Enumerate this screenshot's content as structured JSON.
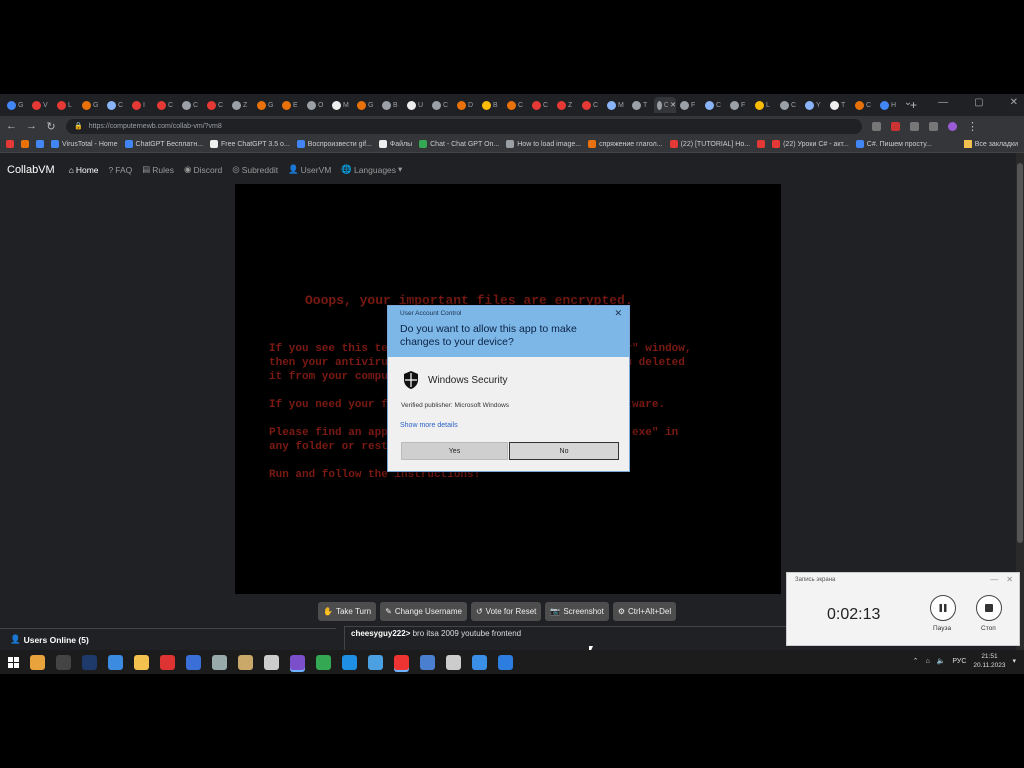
{
  "browser": {
    "tabs": [
      {
        "t": "G",
        "c": "#4285f4"
      },
      {
        "t": "V",
        "c": "#e53935"
      },
      {
        "t": "L",
        "c": "#e53935"
      },
      {
        "t": "G",
        "c": "#e8710a"
      },
      {
        "t": "C",
        "c": "#8ab4f8"
      },
      {
        "t": "I",
        "c": "#e53935"
      },
      {
        "t": "C",
        "c": "#e53935"
      },
      {
        "t": "C",
        "c": "#9aa0a6"
      },
      {
        "t": "C",
        "c": "#e53935"
      },
      {
        "t": "Z",
        "c": "#9aa0a6"
      },
      {
        "t": "G",
        "c": "#e8710a"
      },
      {
        "t": "E",
        "c": "#e8710a"
      },
      {
        "t": "O",
        "c": "#9aa0a6"
      },
      {
        "t": "M",
        "c": "#eee"
      },
      {
        "t": "G",
        "c": "#e8710a"
      },
      {
        "t": "B",
        "c": "#9aa0a6"
      },
      {
        "t": "U",
        "c": "#eee"
      },
      {
        "t": "C",
        "c": "#9aa0a6"
      },
      {
        "t": "D",
        "c": "#e8710a"
      },
      {
        "t": "B",
        "c": "#fbbc04"
      },
      {
        "t": "C",
        "c": "#e8710a"
      },
      {
        "t": "C",
        "c": "#e53935"
      },
      {
        "t": "Z",
        "c": "#e53935"
      },
      {
        "t": "C",
        "c": "#e53935"
      },
      {
        "t": "M",
        "c": "#8ab4f8"
      },
      {
        "t": "T",
        "c": "#9aa0a6"
      },
      {
        "t": "C",
        "c": "#9aa0a6"
      },
      {
        "t": "F",
        "c": "#9aa0a6"
      },
      {
        "t": "C",
        "c": "#8ab4f8"
      },
      {
        "t": "F",
        "c": "#9aa0a6"
      },
      {
        "t": "L",
        "c": "#fbbc04"
      },
      {
        "t": "C",
        "c": "#9aa0a6"
      },
      {
        "t": "Y",
        "c": "#8ab4f8"
      },
      {
        "t": "T",
        "c": "#eee"
      },
      {
        "t": "C",
        "c": "#e8710a"
      },
      {
        "t": "H",
        "c": "#4285f4"
      }
    ],
    "active_tab_index": 26,
    "new_tab": "+",
    "window_controls": [
      "⌄",
      "—",
      "▢",
      "✕"
    ],
    "url": "https://computernewb.com/collab-vm/?vm8",
    "bookmarks": [
      {
        "label": "",
        "c": "#e53935"
      },
      {
        "label": "",
        "c": "#e8710a"
      },
      {
        "label": "",
        "c": "#4285f4"
      },
      {
        "label": "VirusTotal - Home",
        "c": "#4285f4"
      },
      {
        "label": "ChatGPT Бесплатн...",
        "c": "#4285f4"
      },
      {
        "label": "Free ChatGPT 3.5 o...",
        "c": "#eee"
      },
      {
        "label": "Воспроизвести gif...",
        "c": "#4285f4"
      },
      {
        "label": "Файлы",
        "c": "#eee"
      },
      {
        "label": "Chat - Chat GPT On...",
        "c": "#34a853"
      },
      {
        "label": "How to load image...",
        "c": "#9aa0a6"
      },
      {
        "label": "спряжение глагол...",
        "c": "#e8710a"
      },
      {
        "label": "(22) [TUTORIAL] Ho...",
        "c": "#e53935"
      },
      {
        "label": "",
        "c": "#e53935"
      },
      {
        "label": "(22) Уроки C# - акт...",
        "c": "#e53935"
      },
      {
        "label": "C#. Пишем просту...",
        "c": "#4285f4"
      }
    ],
    "bookmarks_other": "Все закладки"
  },
  "site": {
    "brand": "CollabVM",
    "nav": [
      "Home",
      "FAQ",
      "Rules",
      "Discord",
      "Subreddit",
      "UserVM",
      "Languages"
    ]
  },
  "vm": {
    "ransom_title": "Ooops, your important files are encrypted.",
    "ransom_body": "If you see this text, but don't see the \"Wana Decrypt0r\" window,\nthen your antivirus removed the decrypt software or you deleted\nit from your computer.\n\nIf you need your files you have to run the decrypt software.\n\nPlease find an application file named \"@WanaDecryptor@.exe\" in\nany folder or restore from the antivirus quarantine.\n\nRun and follow the instructions!"
  },
  "uac": {
    "caption": "User Account Control",
    "question": "Do you want to allow this app to make changes to your device?",
    "app_name": "Windows Security",
    "publisher": "Verified publisher: Microsoft Windows",
    "more_details": "Show more details",
    "yes": "Yes",
    "no": "No"
  },
  "vm_buttons": [
    "Take Turn",
    "Change Username",
    "Vote for Reset",
    "Screenshot",
    "Ctrl+Alt+Del"
  ],
  "users_online": "Users Online (5)",
  "chat": {
    "user": "cheesyguy222",
    "sep": ">",
    "message": " bro itsa 2009 youtube frontend"
  },
  "recorder": {
    "title": "Запись экрана",
    "time": "0:02:13",
    "pause": "Пауза",
    "stop": "Стоп"
  },
  "taskbar": {
    "icons": [
      {
        "name": "file-explorer-icon",
        "c": "#e8a33d"
      },
      {
        "name": "terminal-icon",
        "c": "#444"
      },
      {
        "name": "photoshop-icon",
        "c": "#1e3a6b"
      },
      {
        "name": "app-icon",
        "c": "#3b8be0"
      },
      {
        "name": "folder-icon",
        "c": "#f2c14e"
      },
      {
        "name": "app-icon",
        "c": "#d33"
      },
      {
        "name": "app-icon",
        "c": "#3a6fd8"
      },
      {
        "name": "app-icon",
        "c": "#9aa"
      },
      {
        "name": "app-icon",
        "c": "#c9a86a"
      },
      {
        "name": "app-icon",
        "c": "#ccc"
      },
      {
        "name": "visual-studio-icon",
        "c": "#7b4fc9"
      },
      {
        "name": "chrome-icon",
        "c": "#34a853"
      },
      {
        "name": "skype-icon",
        "c": "#1e8fe3"
      },
      {
        "name": "app-icon",
        "c": "#4aa0e0"
      },
      {
        "name": "recorder-icon",
        "c": "#e33"
      },
      {
        "name": "app-icon",
        "c": "#4a7fd0"
      },
      {
        "name": "settings-icon",
        "c": "#ccc"
      },
      {
        "name": "app-icon",
        "c": "#3a8ee6"
      },
      {
        "name": "app-icon",
        "c": "#2d7de0"
      }
    ],
    "tray_lang": "РУС",
    "clock_time": "21:51",
    "clock_date": "20.11.2023"
  }
}
